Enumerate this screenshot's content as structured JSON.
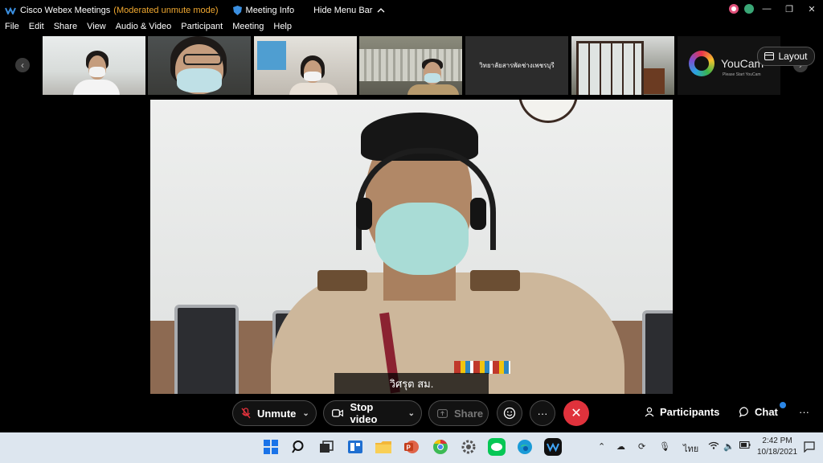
{
  "titlebar": {
    "app_title": "Cisco Webex Meetings",
    "mode": "(Moderated unmute mode)",
    "meeting_info": "Meeting Info",
    "hide_menu": "Hide Menu Bar"
  },
  "menu": [
    "File",
    "Edit",
    "Share",
    "View",
    "Audio & Video",
    "Participant",
    "Meeting",
    "Help"
  ],
  "thumbnails": {
    "tile5_text": "วิทยาลัยสารพัดช่างเพชรบุรี",
    "tile7_brand": "YouCam",
    "tile7_sub": "Please Start YouCam"
  },
  "layout_button": "Layout",
  "main_video": {
    "speaker_name": "วิศรุต สม."
  },
  "controls": {
    "unmute": "Unmute",
    "stop_video": "Stop video",
    "share": "Share",
    "participants": "Participants",
    "chat": "Chat"
  },
  "taskbar": {
    "time": "2:42 PM",
    "date": "10/18/2021",
    "language": "ไทย"
  },
  "colors": {
    "mode_text": "#f0a830",
    "end_call": "#e0323c",
    "chat_badge": "#2b86e6",
    "taskbar_bg": "#dde6ef"
  }
}
